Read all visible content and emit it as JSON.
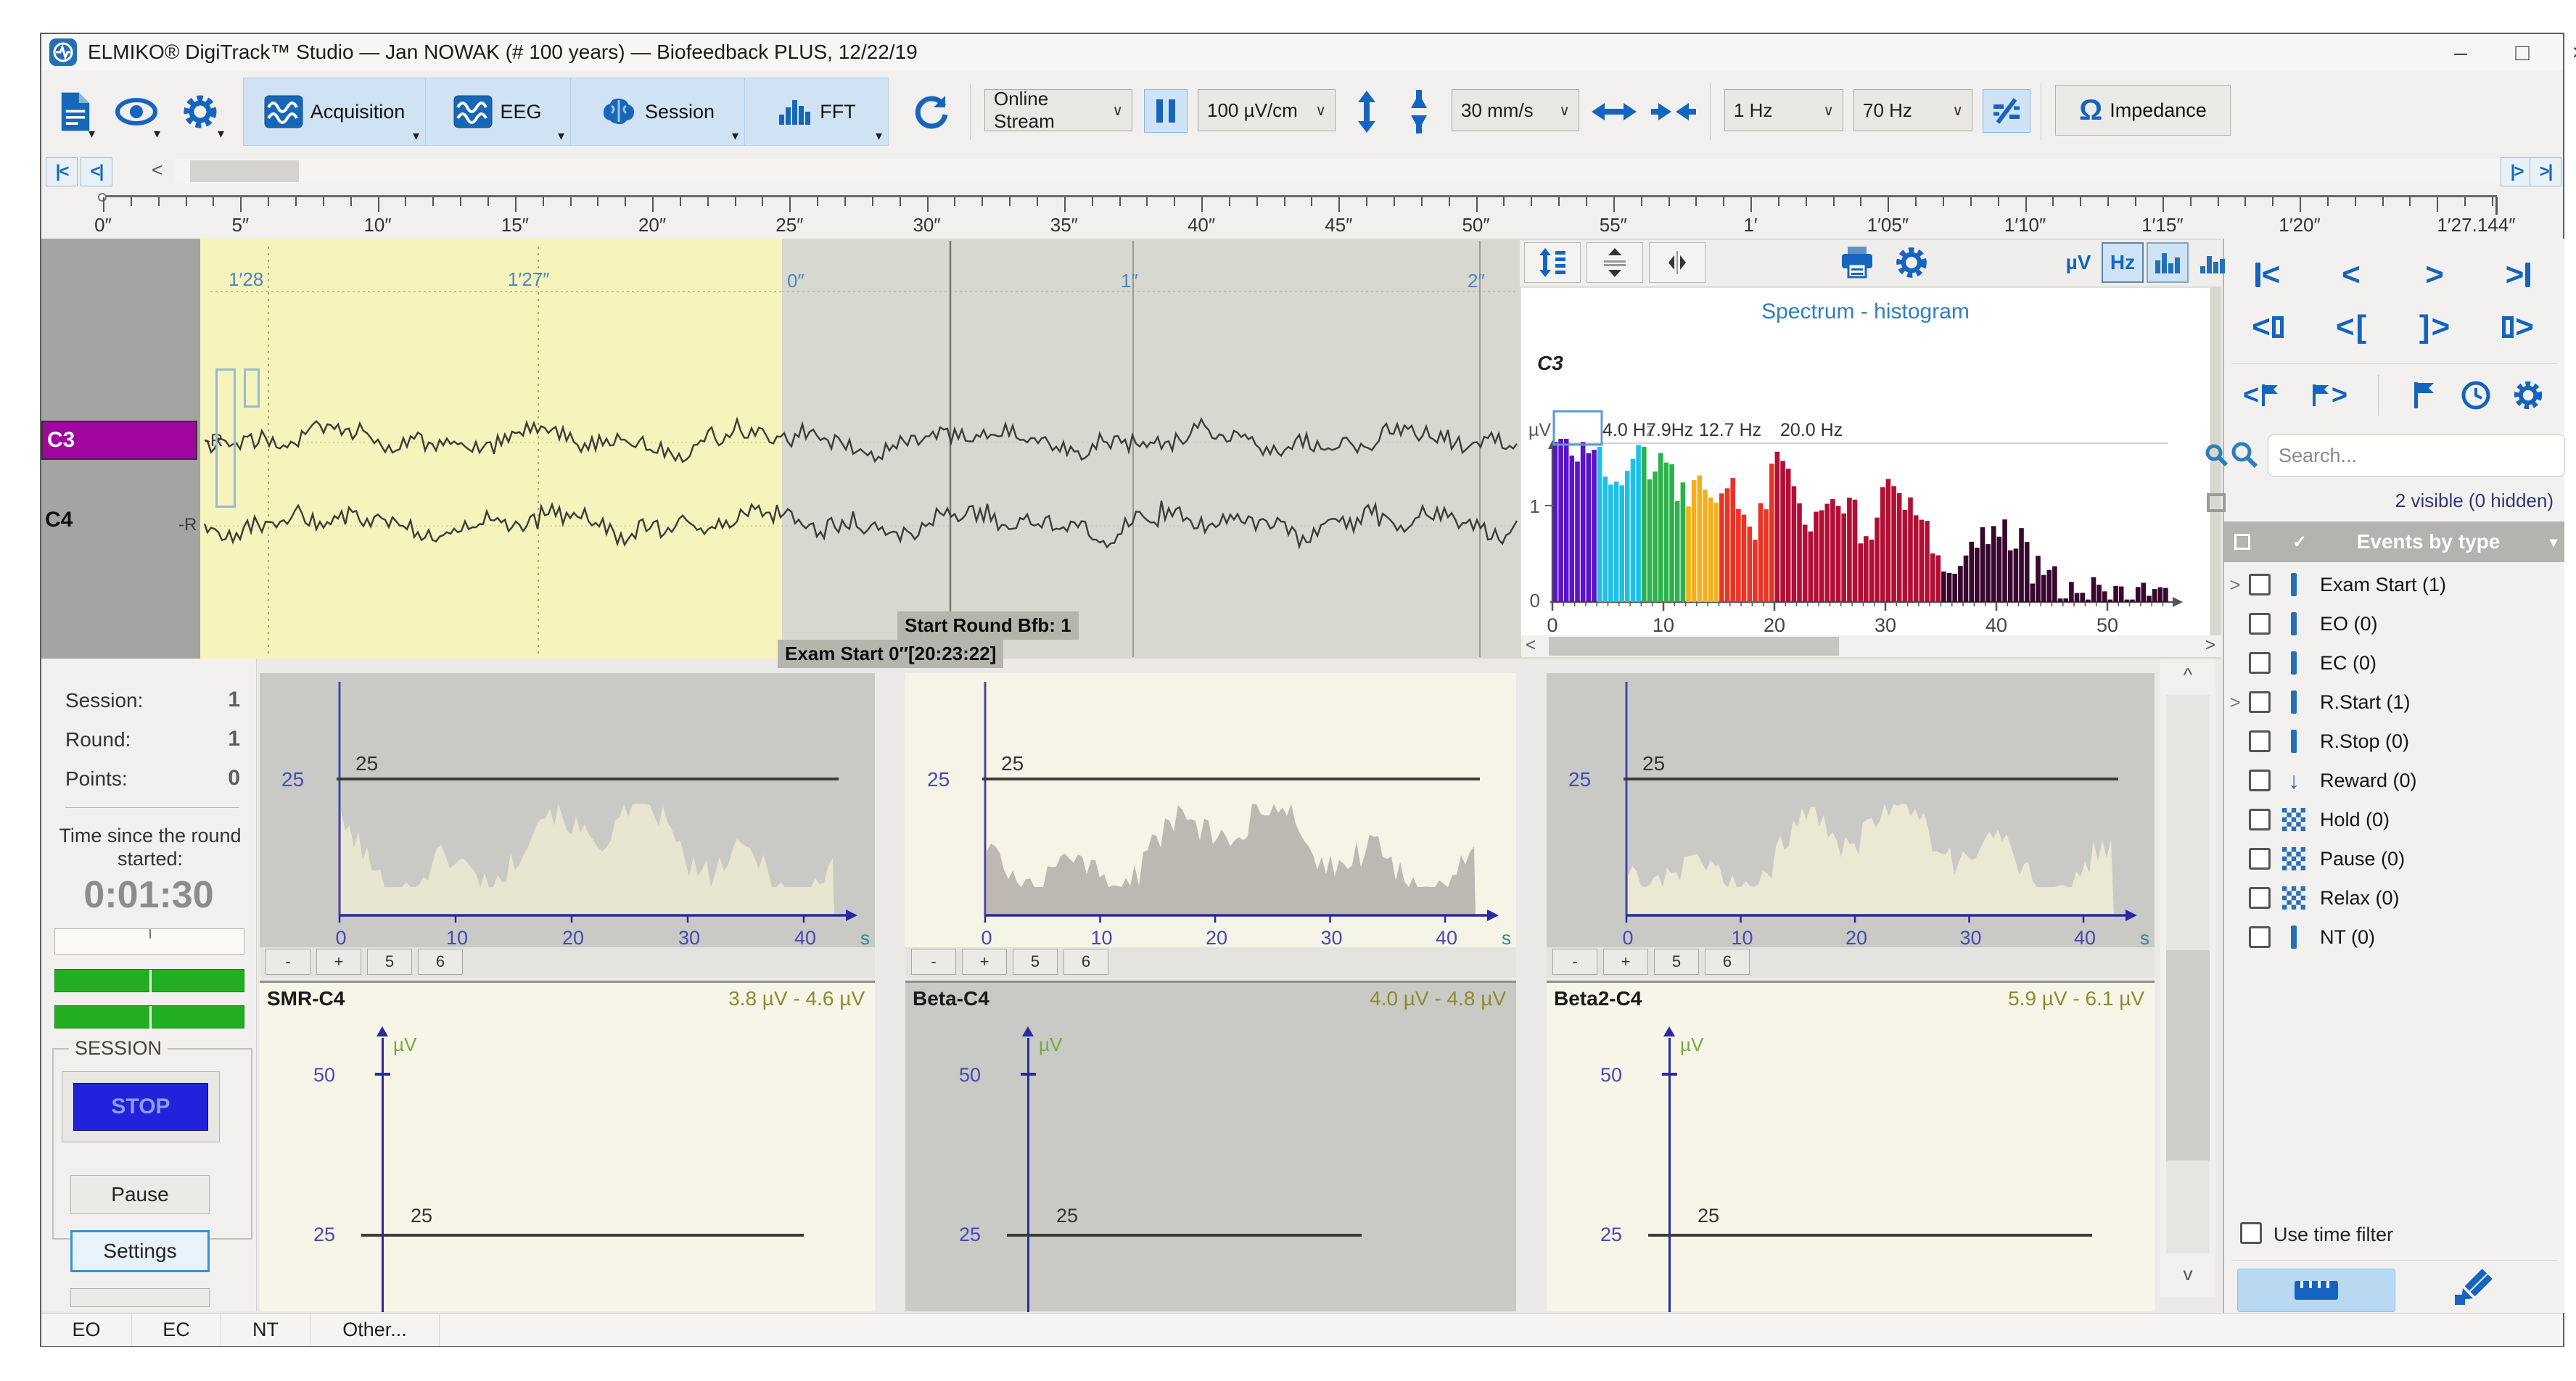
{
  "window": {
    "title": "ELMIKO® DigiTrack™ Studio — Jan NOWAK (# 100 years) — Biofeedback PLUS, 12/22/19",
    "minimize": "–",
    "maximize": "□",
    "close": "×"
  },
  "toolbar": {
    "acquisition": "Acquisition",
    "eeg": "EEG",
    "session": "Session",
    "fft": "FFT",
    "stream_value": "Online Stream",
    "gain_value": "100 µV/cm",
    "speed_value": "30 mm/s",
    "highpass_value": "1 Hz",
    "lowpass_value": "70 Hz",
    "omega": "Ω",
    "impedance_label": "Impedance"
  },
  "ruler": {
    "labels": [
      {
        "t": 0,
        "text": "0″"
      },
      {
        "t": 5,
        "text": "5″"
      },
      {
        "t": 10,
        "text": "10″"
      },
      {
        "t": 15,
        "text": "15″"
      },
      {
        "t": 20,
        "text": "20″"
      },
      {
        "t": 25,
        "text": "25″"
      },
      {
        "t": 30,
        "text": "30″"
      },
      {
        "t": 35,
        "text": "35″"
      },
      {
        "t": 40,
        "text": "40″"
      },
      {
        "t": 45,
        "text": "45″"
      },
      {
        "t": 50,
        "text": "50″"
      },
      {
        "t": 55,
        "text": "55″"
      },
      {
        "t": 60,
        "text": "1′"
      },
      {
        "t": 65,
        "text": "1′05″"
      },
      {
        "t": 70,
        "text": "1′10″"
      },
      {
        "t": 75,
        "text": "1′15″"
      },
      {
        "t": 80,
        "text": "1′20″"
      },
      {
        "t": 87.144,
        "text": "1′27.144″"
      }
    ]
  },
  "trace": {
    "channels": [
      {
        "name": "C3",
        "ref": "-R"
      },
      {
        "name": "C4",
        "ref": "-R"
      }
    ],
    "segment_labels": [
      {
        "text": "1′28"
      },
      {
        "text": "1′27″"
      },
      {
        "text": "0″"
      },
      {
        "text": "1″"
      },
      {
        "text": "2″"
      }
    ],
    "markers": {
      "round": "Start Round Bfb: 1",
      "exam": "Exam Start 0″[20:23:22]"
    }
  },
  "spectrum": {
    "title": "Spectrum - histogram",
    "channel": "C3",
    "y_unit": "µV",
    "y_ticks": [
      "1",
      "0"
    ],
    "x_ticks": [
      "0",
      "10",
      "20",
      "30",
      "40",
      "50"
    ],
    "band_labels": [
      {
        "text": "4.0 Hz",
        "hz": 4
      },
      {
        "text": "7.9Hz",
        "hz": 7.9
      },
      {
        "text": "12.7 Hz",
        "hz": 12.7
      },
      {
        "text": "20.0 Hz",
        "hz": 20
      }
    ],
    "bands": [
      {
        "to": 4,
        "color": "#5a14c8"
      },
      {
        "to": 8,
        "color": "#1fc0e8"
      },
      {
        "to": 12,
        "color": "#2cb14c"
      },
      {
        "to": 15,
        "color": "#f2b01e"
      },
      {
        "to": 20,
        "color": "#e83426"
      },
      {
        "to": 35,
        "color": "#b20e34"
      },
      {
        "to": 56,
        "color": "#38082e"
      }
    ]
  },
  "session_panel": {
    "session_label": "Session:",
    "session_value": "1",
    "round_label": "Round:",
    "round_value": "1",
    "points_label": "Points:",
    "points_value": "0",
    "timer_label": "Time since the round started:",
    "timer_value": "0:01:30",
    "group_label": "SESSION",
    "stop": "STOP",
    "pause": "Pause",
    "settings": "Settings"
  },
  "band_charts": {
    "threshold": "25",
    "x_ticks": [
      "0",
      "10",
      "20",
      "30",
      "40"
    ],
    "x_unit": "s",
    "buttons": [
      "-",
      "+",
      "5",
      "6"
    ]
  },
  "threshold_panels": {
    "y_top": "50",
    "y_mid": "25",
    "unit": "µV",
    "panels": [
      {
        "title": "SMR-C4",
        "range": "3.8 µV - 4.6 µV"
      },
      {
        "title": "Beta-C4",
        "range": "4.0 µV - 4.8 µV"
      },
      {
        "title": "Beta2-C4",
        "range": "5.9 µV - 6.1 µV"
      }
    ]
  },
  "events_panel": {
    "search_placeholder": "Search...",
    "visible_summary": "2 visible (0 hidden)",
    "header": "Events by type",
    "items": [
      {
        "label": "Exam Start (1)",
        "icon": "bar",
        "expand": true
      },
      {
        "label": "EO (0)",
        "icon": "bar",
        "expand": false
      },
      {
        "label": "EC (0)",
        "icon": "bar",
        "expand": false
      },
      {
        "label": "R.Start (1)",
        "icon": "bar",
        "expand": true
      },
      {
        "label": "R.Stop (0)",
        "icon": "bar",
        "expand": false
      },
      {
        "label": "Reward (0)",
        "icon": "arrow",
        "expand": false
      },
      {
        "label": "Hold (0)",
        "icon": "checker",
        "expand": false
      },
      {
        "label": "Pause (0)",
        "icon": "checker",
        "expand": false
      },
      {
        "label": "Relax (0)",
        "icon": "checker",
        "expand": false
      },
      {
        "label": "NT (0)",
        "icon": "bar",
        "expand": false
      }
    ],
    "use_time_filter": "Use time filter"
  },
  "statusbar": {
    "buttons": [
      "EO",
      "EC",
      "NT",
      "Other..."
    ]
  },
  "colors": {
    "accent": "#1565c0",
    "selection_bg": "#cfe3f4",
    "yellow_region": "#f7f3bc",
    "gray_region": "#d7d8d0",
    "magenta_label": "#a0059d",
    "stop_blue": "#2222dd",
    "green_bar": "#22ad22"
  }
}
